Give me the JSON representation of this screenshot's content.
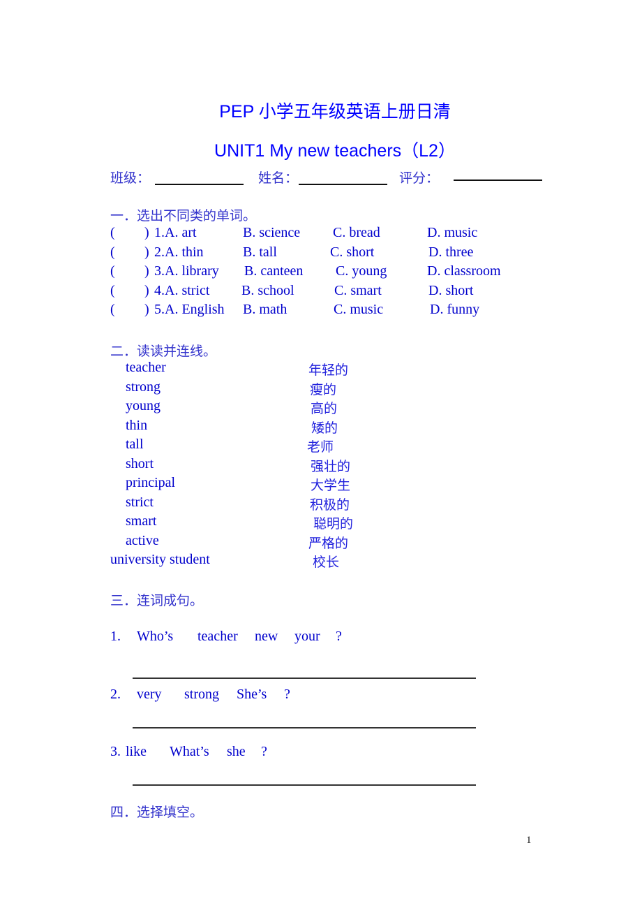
{
  "header": {
    "title": "PEP 小学五年级英语上册日清",
    "subtitle": "UNIT1 My new teachers（L2）",
    "fields": [
      {
        "label": "班级："
      },
      {
        "label": "姓名："
      },
      {
        "label": "评分："
      }
    ]
  },
  "section1": {
    "heading": "一．选出不同类的单词。",
    "questions": [
      {
        "paren": "(",
        "close": ")",
        "num": "1.",
        "a": "A. art",
        "b": "B. science",
        "c": "C. bread",
        "d": "D. music"
      },
      {
        "paren": "(",
        "close": ")",
        "num": "2.",
        "a": "A. thin",
        "b": "B. tall",
        "c": "C. short",
        "d": "D. three"
      },
      {
        "paren": "(",
        "close": ")",
        "num": "3.",
        "a": "A. library",
        "b": "B. canteen",
        "c": "C. young",
        "d": "D. classroom"
      },
      {
        "paren": "(",
        "close": ")",
        "num": "4.",
        "a": "A. strict",
        "b": "B. school",
        "c": "C. smart",
        "d": "D. short"
      },
      {
        "paren": "(",
        "close": ")",
        "num": "5.",
        "a": "A. English",
        "b": "B. math",
        "c": "C. music",
        "d": "D. funny"
      }
    ]
  },
  "section2": {
    "heading": "二．读读并连线。",
    "english": [
      "teacher",
      "strong",
      "young",
      "thin",
      "tall",
      "short",
      "principal",
      "strict",
      "smart",
      "active",
      "university student"
    ],
    "chinese": [
      "年轻的",
      "瘦的",
      "高的",
      "矮的",
      "老师",
      "强壮的",
      "大学生",
      "积极的",
      "聪明的",
      "严格的",
      "校长"
    ]
  },
  "section3": {
    "heading": "三．连词成句。",
    "items": [
      {
        "num": "1.",
        "words": [
          "Who’s",
          "teacher",
          "new",
          "your",
          "?"
        ]
      },
      {
        "num": "2.",
        "words": [
          "very",
          "strong",
          "She’s",
          "?"
        ]
      },
      {
        "num": "3.",
        "words": [
          "like",
          "What’s",
          "she",
          "?"
        ]
      }
    ]
  },
  "section4": {
    "heading": "四．选择填空。"
  },
  "footer": {
    "page_number": "1"
  }
}
